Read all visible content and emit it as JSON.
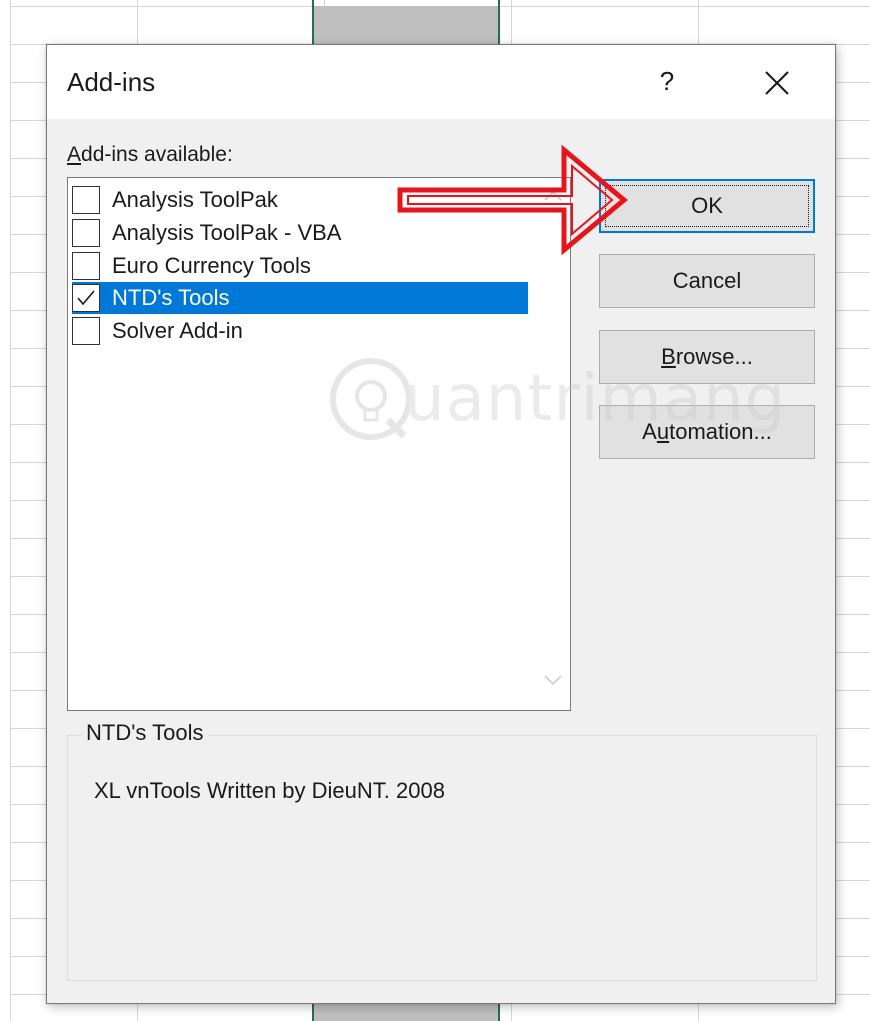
{
  "dialog": {
    "title": "Add-ins",
    "help_symbol": "?",
    "available_label_accel": "A",
    "available_label_rest": "dd-ins available:",
    "addins": [
      {
        "label": "Analysis ToolPak",
        "checked": false,
        "selected": false
      },
      {
        "label": "Analysis ToolPak - VBA",
        "checked": false,
        "selected": false
      },
      {
        "label": "Euro Currency Tools",
        "checked": false,
        "selected": false
      },
      {
        "label": "NTD's Tools",
        "checked": true,
        "selected": true
      },
      {
        "label": "Solver Add-in",
        "checked": false,
        "selected": false
      }
    ],
    "buttons": {
      "ok": "OK",
      "cancel": "Cancel",
      "browse_accel": "B",
      "browse_rest": "rowse...",
      "automation_pre": "A",
      "automation_accel": "u",
      "automation_rest": "tomation..."
    },
    "description": {
      "title": "NTD's Tools",
      "text": "XL vnTools Written by DieuNT. 2008"
    }
  },
  "watermark": {
    "text": "uantrimang"
  },
  "colors": {
    "selection": "#0078d7",
    "annotation_arrow": "#e8141c",
    "sheet_selected_border": "#217346"
  }
}
